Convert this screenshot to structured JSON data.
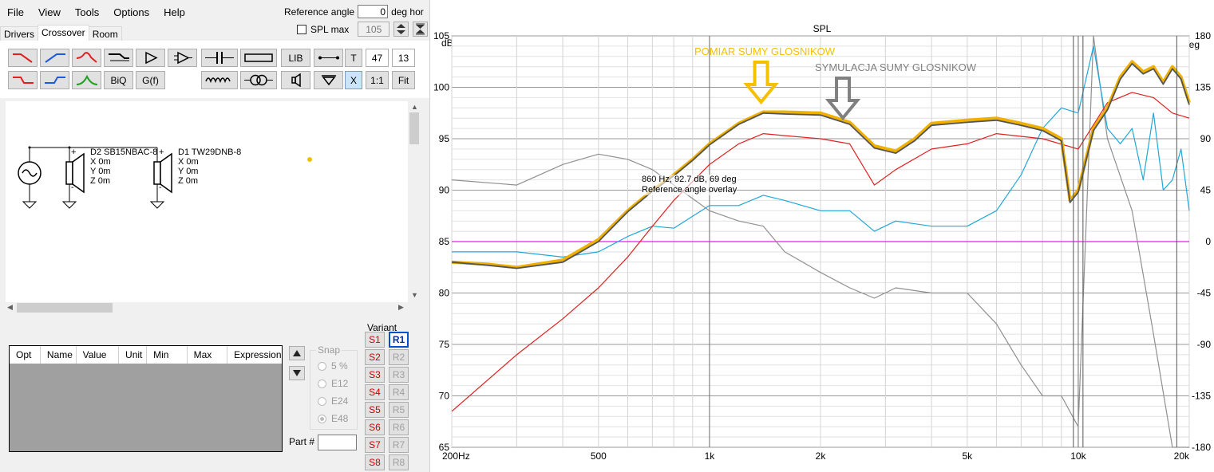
{
  "menu": [
    "File",
    "View",
    "Tools",
    "Options",
    "Help"
  ],
  "reference": {
    "label": "Reference angle",
    "value": "0",
    "unit": "deg hor"
  },
  "spl_max": {
    "label": "SPL max",
    "value": "105",
    "checked": false
  },
  "tabs": [
    "Drivers",
    "Crossover",
    "Room"
  ],
  "active_tab": "Crossover",
  "toolbar": {
    "lib": "LIB",
    "t": "T",
    "x": "X",
    "biq": "BiQ",
    "gf": "G(f)",
    "one": "1:1",
    "fit": "Fit",
    "num1": "47",
    "num2": "13"
  },
  "schematic": {
    "d2": {
      "name": "D2 SB15NBAC-8",
      "x": "X 0m",
      "y": "Y 0m",
      "z": "Z 0m"
    },
    "d1": {
      "name": "D1 TW29DNB-8",
      "x": "X 0m",
      "y": "Y 0m",
      "z": "Z 0m"
    },
    "plus": "+",
    "minus": "-"
  },
  "table": {
    "columns": [
      "Opt",
      "Name",
      "Value",
      "Unit",
      "Min",
      "Max",
      "Expression"
    ]
  },
  "snap": {
    "title": "Snap",
    "options": [
      "5 %",
      "E12",
      "E24",
      "E48"
    ],
    "selected": "E48"
  },
  "part_label": "Part #",
  "variant": {
    "title": "Variant",
    "s": [
      "S1",
      "S2",
      "S3",
      "S4",
      "S5",
      "S6",
      "S7",
      "S8"
    ],
    "r": [
      "R1",
      "R2",
      "R3",
      "R4",
      "R5",
      "R6",
      "R7",
      "R8"
    ],
    "selected": "R1"
  },
  "chart": {
    "title": "SPL",
    "yunit_left": "dB",
    "yunit_right": "deg",
    "cursor_text": "860 Hz, 92.7 dB, 69 deg",
    "cursor_sub": "Reference angle overlay",
    "annotation_measured": "POMIAR SUMY GLOSNIKOW",
    "annotation_sim": "SYMULACJA SUMY GLOSNIKOW",
    "colors": {
      "measured": "#f0b000",
      "sim": "#555555",
      "red": "#e02020",
      "blue": "#20a8d8",
      "gray": "#909090",
      "magenta": "#e020e0",
      "arrow_measured": "#f5c000",
      "arrow_sim": "#808080"
    }
  },
  "chart_data": {
    "type": "line",
    "title": "SPL",
    "xlabel": "",
    "ylabel": "dB",
    "xscale": "log",
    "xlim": [
      200,
      20000
    ],
    "ylim": [
      65,
      105
    ],
    "y2lim": [
      -180,
      180
    ],
    "x_ticks": [
      "200Hz",
      "500",
      "1k",
      "2k",
      "5k",
      "10k",
      "20k"
    ],
    "y_ticks": [
      "105",
      "100",
      "95",
      "90",
      "85",
      "80",
      "75",
      "70",
      "65"
    ],
    "y2_ticks": [
      "180",
      "135",
      "90",
      "45",
      "0",
      "-45",
      "-90",
      "-135",
      "-180"
    ],
    "series": [
      {
        "name": "",
        "color": "#f0b000",
        "x": [
          200,
          250,
          300,
          400,
          500,
          600,
          700,
          800,
          900,
          1000,
          1200,
          1400,
          1600,
          2000,
          2400,
          2800,
          3200,
          3600,
          4000,
          5000,
          6000,
          7000,
          8000,
          9000,
          9500,
          10000,
          11000,
          12000,
          13000,
          14000,
          15000,
          16000,
          17000,
          18000,
          19000,
          20000
        ],
        "y": [
          83,
          82.8,
          82.5,
          83.2,
          85.2,
          88,
          90,
          91.5,
          93,
          94.5,
          96.5,
          97.6,
          97.6,
          97.5,
          96.6,
          94.3,
          93.8,
          95,
          96.5,
          96.8,
          97,
          96.5,
          96,
          95,
          89,
          90,
          96,
          98,
          101,
          102.5,
          101.5,
          102,
          100.5,
          102,
          101,
          98.5
        ]
      },
      {
        "name": "",
        "color": "#555555",
        "x": [
          200,
          250,
          300,
          400,
          500,
          600,
          700,
          800,
          900,
          1000,
          1200,
          1400,
          1600,
          2000,
          2400,
          2800,
          3200,
          3600,
          4000,
          5000,
          6000,
          7000,
          8000,
          9000,
          9500,
          10000,
          11000,
          12000,
          13000,
          14000,
          15000,
          16000,
          17000,
          18000,
          19000,
          20000
        ],
        "y": [
          83,
          82.7,
          82.4,
          83,
          85,
          87.9,
          89.9,
          91.4,
          92.9,
          94.4,
          96.4,
          97.5,
          97.4,
          97.3,
          96.4,
          94.1,
          93.6,
          94.8,
          96.3,
          96.6,
          96.8,
          96.3,
          95.8,
          94.8,
          88.8,
          89.8,
          95.8,
          97.8,
          100.8,
          102.3,
          101.3,
          101.8,
          100.3,
          101.8,
          100.8,
          98.3
        ]
      },
      {
        "name": "",
        "color": "#e02020",
        "x": [
          200,
          300,
          400,
          500,
          600,
          700,
          800,
          1000,
          1200,
          1400,
          1600,
          2000,
          2400,
          2800,
          3200,
          4000,
          5000,
          6000,
          8000,
          10000,
          12000,
          14000,
          16000,
          18000,
          20000
        ],
        "y": [
          68.5,
          74,
          77.5,
          80.5,
          83.5,
          86.5,
          89,
          92.5,
          94.5,
          95.5,
          95.3,
          95,
          94.5,
          90.5,
          92,
          94,
          94.5,
          95.5,
          95,
          94,
          98.5,
          99.5,
          99,
          97.5,
          97
        ]
      },
      {
        "name": "",
        "color": "#20a8d8",
        "x": [
          200,
          300,
          400,
          500,
          600,
          700,
          800,
          1000,
          1200,
          1400,
          1600,
          2000,
          2400,
          2800,
          3200,
          4000,
          5000,
          6000,
          7000,
          8000,
          9000,
          10000,
          11000,
          12000,
          13000,
          14000,
          15000,
          16000,
          17000,
          18000,
          19000,
          20000
        ],
        "y": [
          84,
          84,
          83.5,
          84,
          85.5,
          86.5,
          86.3,
          88.5,
          88.5,
          89.5,
          89,
          88,
          88,
          86,
          87,
          86.5,
          86.5,
          88,
          91.5,
          96,
          98,
          97.5,
          104,
          96,
          94.5,
          96,
          91,
          97.5,
          90,
          91,
          94,
          88
        ]
      },
      {
        "name": "",
        "color": "#909090",
        "x": [
          200,
          300,
          400,
          500,
          600,
          700,
          800,
          1000,
          1200,
          1400,
          1600,
          2000,
          2400,
          2800,
          3200,
          4000,
          5000,
          6000,
          7000,
          8000,
          9000,
          10000,
          11000,
          12000,
          14000,
          16000,
          18000,
          20000
        ],
        "y": [
          91,
          90.5,
          92.5,
          93.5,
          93,
          92,
          90.5,
          88,
          87,
          86.5,
          84,
          82,
          80.5,
          79.5,
          80.5,
          80,
          80,
          77,
          73,
          70,
          70,
          67,
          105,
          95,
          88,
          76,
          65,
          65
        ]
      },
      {
        "name": "",
        "color": "#e020e0",
        "x": [
          200,
          20000
        ],
        "y": [
          85,
          85
        ]
      }
    ]
  }
}
